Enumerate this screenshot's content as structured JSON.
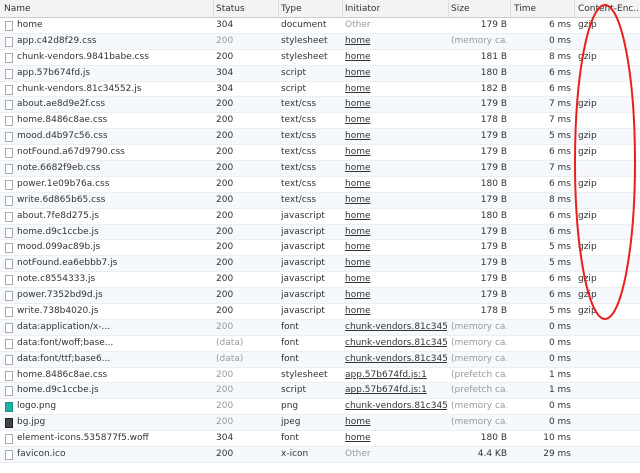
{
  "columns": {
    "name": "Name",
    "status": "Status",
    "type": "Type",
    "initiator": "Initiator",
    "size": "Size",
    "time": "Time",
    "encoding": "Content-Enc..."
  },
  "rows": [
    {
      "name": "home",
      "status": "304",
      "type": "document",
      "initiator": "Other",
      "size": "179 B",
      "time": "6 ms",
      "enc": "gzip",
      "status_gray": false,
      "init_link": false
    },
    {
      "name": "app.c42d8f29.css",
      "status": "200",
      "type": "stylesheet",
      "initiator": "home",
      "size": "(memory ca...",
      "time": "0 ms",
      "enc": "",
      "status_gray": true,
      "init_link": true
    },
    {
      "name": "chunk-vendors.9841babe.css",
      "status": "200",
      "type": "stylesheet",
      "initiator": "home",
      "size": "181 B",
      "time": "8 ms",
      "enc": "gzip",
      "status_gray": false,
      "init_link": true
    },
    {
      "name": "app.57b674fd.js",
      "status": "304",
      "type": "script",
      "initiator": "home",
      "size": "180 B",
      "time": "6 ms",
      "enc": "",
      "status_gray": false,
      "init_link": true
    },
    {
      "name": "chunk-vendors.81c34552.js",
      "status": "304",
      "type": "script",
      "initiator": "home",
      "size": "182 B",
      "time": "6 ms",
      "enc": "",
      "status_gray": false,
      "init_link": true
    },
    {
      "name": "about.ae8d9e2f.css",
      "status": "200",
      "type": "text/css",
      "initiator": "home",
      "size": "179 B",
      "time": "7 ms",
      "enc": "gzip",
      "status_gray": false,
      "init_link": true
    },
    {
      "name": "home.8486c8ae.css",
      "status": "200",
      "type": "text/css",
      "initiator": "home",
      "size": "178 B",
      "time": "7 ms",
      "enc": "",
      "status_gray": false,
      "init_link": true
    },
    {
      "name": "mood.d4b97c56.css",
      "status": "200",
      "type": "text/css",
      "initiator": "home",
      "size": "179 B",
      "time": "5 ms",
      "enc": "gzip",
      "status_gray": false,
      "init_link": true
    },
    {
      "name": "notFound.a67d9790.css",
      "status": "200",
      "type": "text/css",
      "initiator": "home",
      "size": "179 B",
      "time": "6 ms",
      "enc": "gzip",
      "status_gray": false,
      "init_link": true
    },
    {
      "name": "note.6682f9eb.css",
      "status": "200",
      "type": "text/css",
      "initiator": "home",
      "size": "179 B",
      "time": "7 ms",
      "enc": "",
      "status_gray": false,
      "init_link": true
    },
    {
      "name": "power.1e09b76a.css",
      "status": "200",
      "type": "text/css",
      "initiator": "home",
      "size": "180 B",
      "time": "6 ms",
      "enc": "gzip",
      "status_gray": false,
      "init_link": true
    },
    {
      "name": "write.6d865b65.css",
      "status": "200",
      "type": "text/css",
      "initiator": "home",
      "size": "179 B",
      "time": "8 ms",
      "enc": "",
      "status_gray": false,
      "init_link": true
    },
    {
      "name": "about.7fe8d275.js",
      "status": "200",
      "type": "javascript",
      "initiator": "home",
      "size": "180 B",
      "time": "6 ms",
      "enc": "gzip",
      "status_gray": false,
      "init_link": true
    },
    {
      "name": "home.d9c1ccbe.js",
      "status": "200",
      "type": "javascript",
      "initiator": "home",
      "size": "179 B",
      "time": "6 ms",
      "enc": "",
      "status_gray": false,
      "init_link": true
    },
    {
      "name": "mood.099ac89b.js",
      "status": "200",
      "type": "javascript",
      "initiator": "home",
      "size": "179 B",
      "time": "5 ms",
      "enc": "gzip",
      "status_gray": false,
      "init_link": true
    },
    {
      "name": "notFound.ea6ebbb7.js",
      "status": "200",
      "type": "javascript",
      "initiator": "home",
      "size": "179 B",
      "time": "5 ms",
      "enc": "",
      "status_gray": false,
      "init_link": true
    },
    {
      "name": "note.c8554333.js",
      "status": "200",
      "type": "javascript",
      "initiator": "home",
      "size": "179 B",
      "time": "6 ms",
      "enc": "gzip",
      "status_gray": false,
      "init_link": true
    },
    {
      "name": "power.7352bd9d.js",
      "status": "200",
      "type": "javascript",
      "initiator": "home",
      "size": "179 B",
      "time": "6 ms",
      "enc": "gzip",
      "status_gray": false,
      "init_link": true
    },
    {
      "name": "write.738b4020.js",
      "status": "200",
      "type": "javascript",
      "initiator": "home",
      "size": "178 B",
      "time": "5 ms",
      "enc": "gzip",
      "status_gray": false,
      "init_link": true
    },
    {
      "name": "data:application/x-...",
      "status": "200",
      "type": "font",
      "initiator": "chunk-vendors.81c345...",
      "size": "(memory ca...",
      "time": "0 ms",
      "enc": "",
      "status_gray": true,
      "init_link": true
    },
    {
      "name": "data:font/woff;base...",
      "status": "(data)",
      "type": "font",
      "initiator": "chunk-vendors.81c345...",
      "size": "(memory ca...",
      "time": "0 ms",
      "enc": "",
      "status_gray": true,
      "init_link": true
    },
    {
      "name": "data:font/ttf;base6...",
      "status": "(data)",
      "type": "font",
      "initiator": "chunk-vendors.81c345...",
      "size": "(memory ca...",
      "time": "0 ms",
      "enc": "",
      "status_gray": true,
      "init_link": true
    },
    {
      "name": "home.8486c8ae.css",
      "status": "200",
      "type": "stylesheet",
      "initiator": "app.57b674fd.js:1",
      "size": "(prefetch ca...",
      "time": "1 ms",
      "enc": "",
      "status_gray": true,
      "init_link": true
    },
    {
      "name": "home.d9c1ccbe.js",
      "status": "200",
      "type": "script",
      "initiator": "app.57b674fd.js:1",
      "size": "(prefetch ca...",
      "time": "1 ms",
      "enc": "",
      "status_gray": true,
      "init_link": true
    },
    {
      "name": "logo.png",
      "status": "200",
      "type": "png",
      "initiator": "chunk-vendors.81c345...",
      "size": "(memory ca...",
      "time": "0 ms",
      "enc": "",
      "status_gray": true,
      "init_link": true,
      "icon": "img-teal"
    },
    {
      "name": "bg.jpg",
      "status": "200",
      "type": "jpeg",
      "initiator": "home",
      "size": "(memory ca...",
      "time": "0 ms",
      "enc": "",
      "status_gray": true,
      "init_link": true,
      "icon": "img-dark"
    },
    {
      "name": "element-icons.535877f5.woff",
      "status": "304",
      "type": "font",
      "initiator": "home",
      "size": "180 B",
      "time": "10 ms",
      "enc": "",
      "status_gray": false,
      "init_link": true
    },
    {
      "name": "favicon.ico",
      "status": "200",
      "type": "x-icon",
      "initiator": "Other",
      "size": "4.4 KB",
      "time": "29 ms",
      "enc": "",
      "status_gray": false,
      "init_link": false
    }
  ],
  "colors": {
    "annotation": "#e8201c",
    "link": "#333333"
  }
}
